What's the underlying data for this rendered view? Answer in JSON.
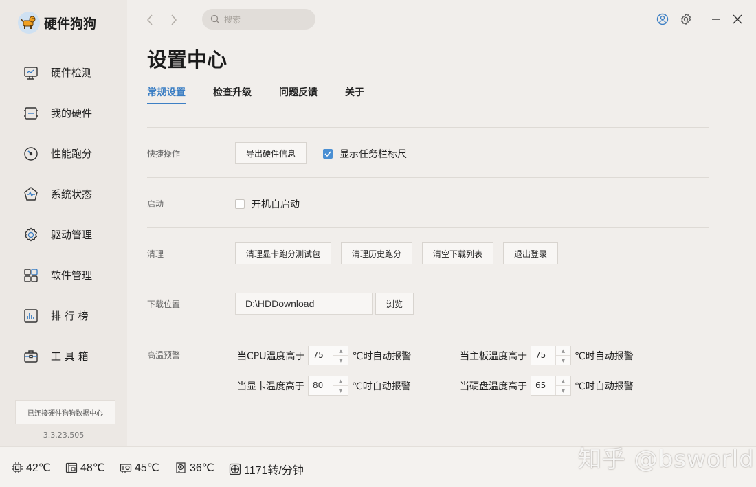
{
  "app": {
    "name": "硬件狗狗",
    "version": "3.3.23.505",
    "connection_status": "已连接硬件狗狗数据中心"
  },
  "sidebar": {
    "items": [
      {
        "label": "硬件检测",
        "icon": "monitor-icon"
      },
      {
        "label": "我的硬件",
        "icon": "hardware-icon"
      },
      {
        "label": "性能跑分",
        "icon": "gauge-icon"
      },
      {
        "label": "系统状态",
        "icon": "pulse-icon"
      },
      {
        "label": "驱动管理",
        "icon": "gear-icon"
      },
      {
        "label": "软件管理",
        "icon": "apps-icon"
      },
      {
        "label": "排 行 榜",
        "icon": "bar-chart-icon"
      },
      {
        "label": "工 具 箱",
        "icon": "toolbox-icon"
      }
    ]
  },
  "topbar": {
    "search_placeholder": "搜索"
  },
  "page": {
    "title": "设置中心",
    "tabs": [
      "常规设置",
      "检查升级",
      "问题反馈",
      "关于"
    ],
    "active_tab": "常规设置"
  },
  "settings": {
    "quick": {
      "label": "快捷操作",
      "export_button": "导出硬件信息",
      "taskbar_ruler": {
        "label": "显示任务栏标尺",
        "checked": true
      }
    },
    "startup": {
      "label": "启动",
      "autostart": {
        "label": "开机自启动",
        "checked": false
      }
    },
    "clean": {
      "label": "清理",
      "buttons": [
        "清理显卡跑分测试包",
        "清理历史跑分",
        "清空下载列表",
        "退出登录"
      ]
    },
    "download": {
      "label": "下载位置",
      "path": "D:\\HDDownload",
      "browse_button": "浏览"
    },
    "temp_warn": {
      "label": "高温预警",
      "cpu": {
        "prefix": "当CPU温度高于",
        "value": "75",
        "suffix": "℃时自动报警"
      },
      "board": {
        "prefix": "当主板温度高于",
        "value": "75",
        "suffix": "℃时自动报警"
      },
      "gpu": {
        "prefix": "当显卡温度高于",
        "value": "80",
        "suffix": "℃时自动报警"
      },
      "disk": {
        "prefix": "当硬盘温度高于",
        "value": "65",
        "suffix": "℃时自动报警"
      }
    }
  },
  "statusbar": {
    "cpu_temp": "42℃",
    "board_temp": "48℃",
    "gpu_temp": "45℃",
    "disk_temp": "36℃",
    "fan_speed": "1171转/分钟"
  },
  "watermark": "知乎 @bsworld",
  "colors": {
    "accent": "#3d7fc4",
    "checkbox": "#4a8fd3",
    "background": "#f1eeeb",
    "sidebar": "#ece8e4"
  }
}
